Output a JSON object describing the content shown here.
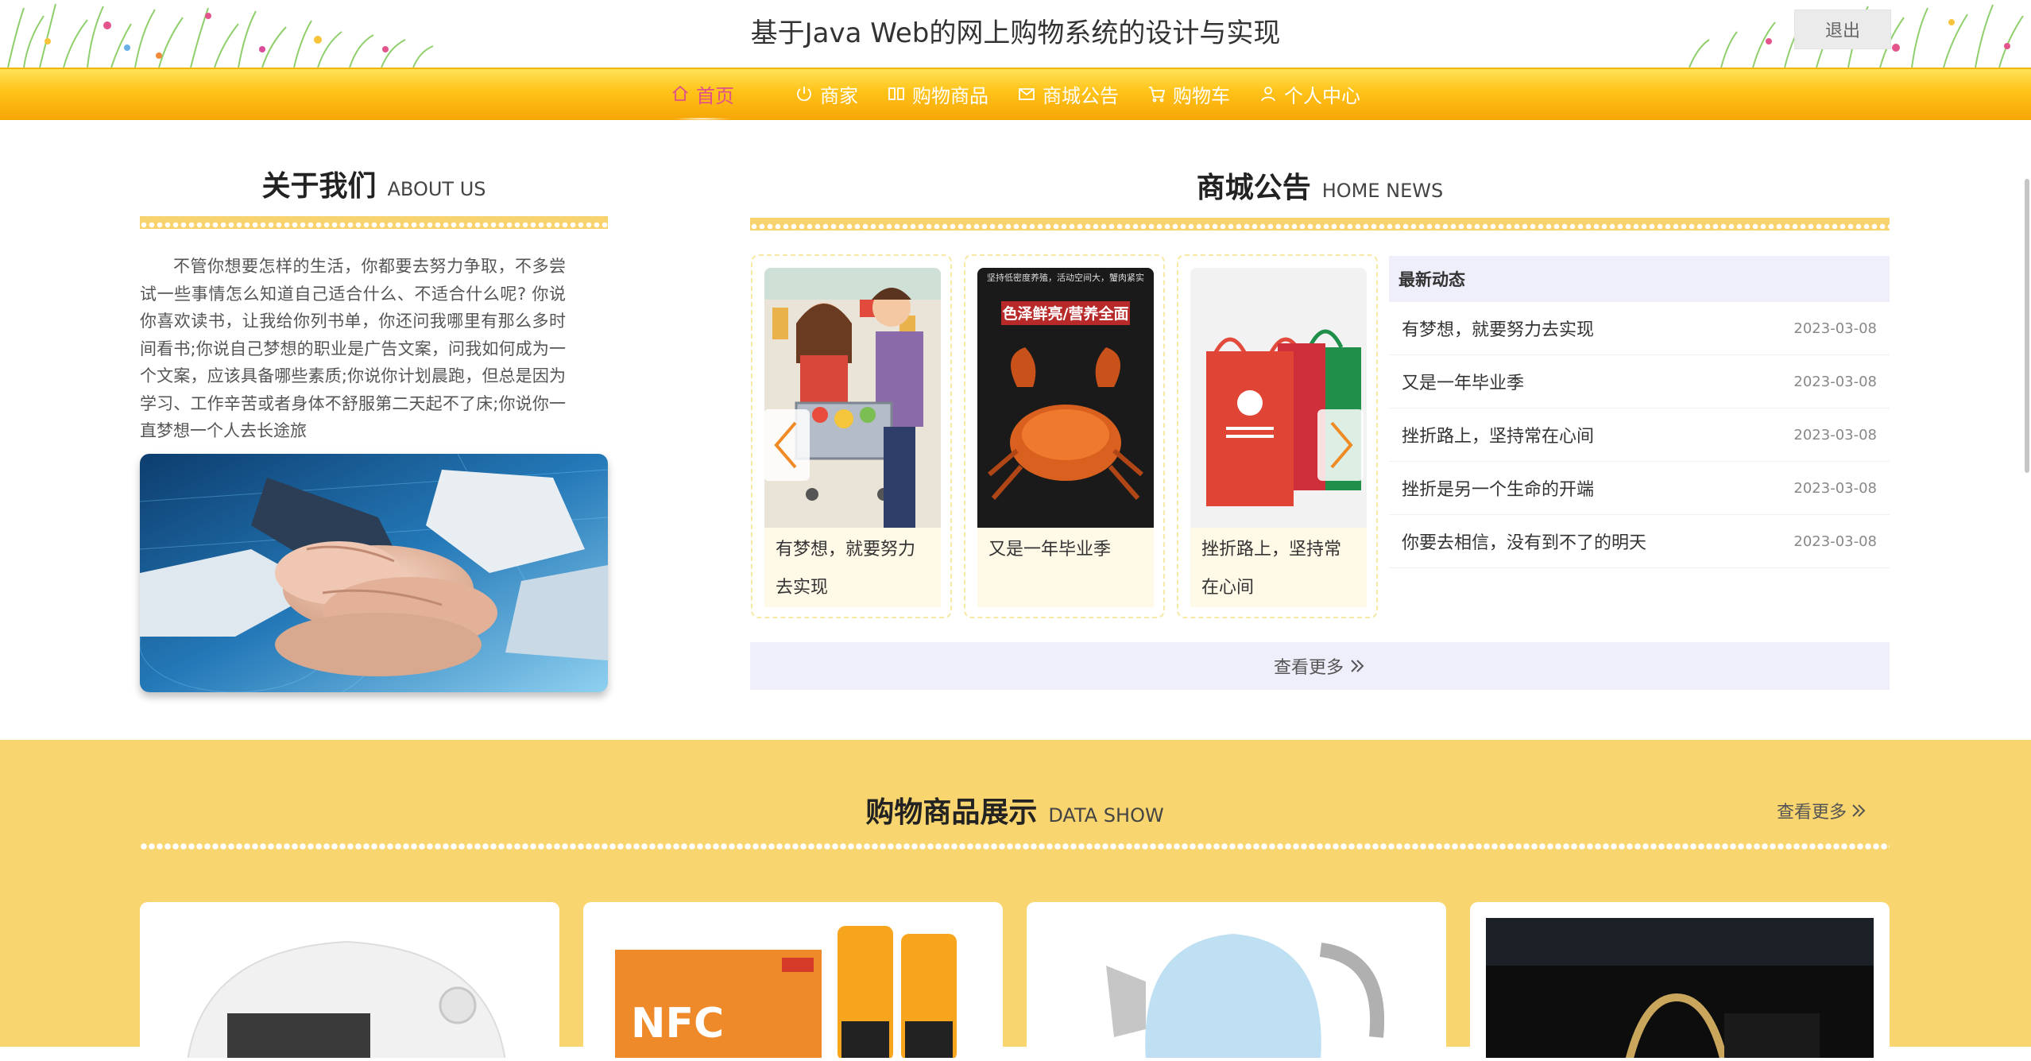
{
  "header": {
    "title": "基于Java Web的网上购物系统的设计与实现",
    "logout_label": "退出"
  },
  "nav": {
    "items": [
      {
        "label": "首页",
        "icon": "home-icon",
        "active": true
      },
      {
        "label": "商家",
        "icon": "power-icon"
      },
      {
        "label": "购物商品",
        "icon": "product-icon"
      },
      {
        "label": "商城公告",
        "icon": "mail-icon"
      },
      {
        "label": "购物车",
        "icon": "cart-icon"
      },
      {
        "label": "个人中心",
        "icon": "user-icon"
      }
    ]
  },
  "about": {
    "title_zh": "关于我们",
    "title_en": "ABOUT US",
    "text": "不管你想要怎样的生活，你都要去努力争取，不多尝试一些事情怎么知道自己适合什么、不适合什么呢? 你说你喜欢读书，让我给你列书单，你还问我哪里有那么多时间看书;你说自己梦想的职业是广告文案，问我如何成为一个文案，应该具备哪些素质;你说你计划晨跑，但总是因为学习、工作辛苦或者身体不舒服第二天起不了床;你说你一直梦想一个人去长途旅"
  },
  "news": {
    "title_zh": "商城公告",
    "title_en": "HOME NEWS",
    "cards": [
      {
        "caption": "有梦想，就要努力去实现",
        "image": "shopping-cartoon"
      },
      {
        "caption": "又是一年毕业季",
        "image": "crab-poster",
        "poster_top": "坚持低密度养殖，活动空间大，蟹肉紧实",
        "poster_banner": "色泽鲜亮/营养全面"
      },
      {
        "caption": "挫折路上，坚持常在心间",
        "image": "shopping-bags"
      }
    ],
    "latest_title": "最新动态",
    "latest": [
      {
        "title": "有梦想，就要努力去实现",
        "date": "2023-03-08"
      },
      {
        "title": "又是一年毕业季",
        "date": "2023-03-08"
      },
      {
        "title": "挫折路上，坚持常在心间",
        "date": "2023-03-08"
      },
      {
        "title": "挫折是另一个生命的开端",
        "date": "2023-03-08"
      },
      {
        "title": "你要去相信，没有到不了的明天",
        "date": "2023-03-08"
      }
    ],
    "more_label": "查看更多"
  },
  "products": {
    "title_zh": "购物商品展示",
    "title_en": "DATA SHOW",
    "more_label": "查看更多",
    "items": [
      {
        "image": "white-appliance"
      },
      {
        "image": "nfc-juice",
        "brand": "NFC"
      },
      {
        "image": "blue-kettle"
      },
      {
        "image": "black-bag"
      }
    ]
  },
  "colors": {
    "nav_gradient_top": "#ffe25a",
    "nav_gradient_bottom": "#f7a708",
    "accent_yellow": "#f9d56f",
    "active_nav": "#e0508a",
    "news_header_bg": "#efeefb"
  }
}
